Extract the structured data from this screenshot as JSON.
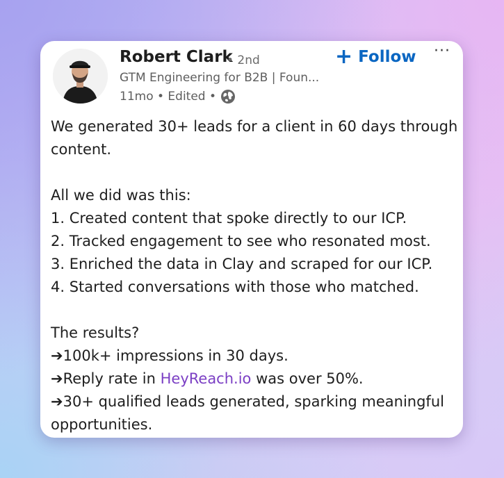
{
  "author": {
    "name": "Robert Clark",
    "degree": "• 2nd",
    "headline": "GTM Engineering for B2B | Foun...",
    "meta": "11mo • Edited •",
    "globe_icon": "globe-icon",
    "avatar_icon": "profile-photo"
  },
  "actions": {
    "follow_plus": "+",
    "follow_label": "Follow",
    "more_label": "···"
  },
  "post": {
    "intro_line1": "We generated 30+ leads for a client in 60 days through",
    "intro_line2": "content.",
    "steps_intro": "All we did was this:",
    "step1": "1. Created content that spoke directly to our ICP.",
    "step2": "2. Tracked engagement to see who resonated most.",
    "step3": "3. Enriched the data in Clay and scraped for our ICP.",
    "step4": "4. Started conversations with those who matched.",
    "results_intro": "The results?",
    "arrow": "➔",
    "result1": "100k+ impressions in 30 days.",
    "result2_prefix": "Reply rate in ",
    "result2_link": "HeyReach.io",
    "result2_suffix": " was over 50%.",
    "result3_line1": "30+ qualified leads generated, sparking meaningful",
    "result3_line2": "opportunities."
  },
  "colors": {
    "accent": "#0a66c2",
    "link": "#7b3fc4"
  }
}
